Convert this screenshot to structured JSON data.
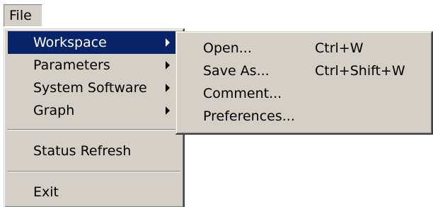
{
  "menubar": {
    "file_label": "File"
  },
  "file_menu": {
    "items": [
      {
        "label": "Workspace"
      },
      {
        "label": "Parameters"
      },
      {
        "label": "System Software"
      },
      {
        "label": "Graph"
      },
      {
        "label": "Status Refresh"
      },
      {
        "label": "Exit"
      }
    ],
    "submenu_arrow_icon": "chevron-right-icon"
  },
  "workspace_submenu": {
    "items": [
      {
        "label": "Open...",
        "shortcut": "Ctrl+W"
      },
      {
        "label": "Save As...",
        "shortcut": "Ctrl+Shift+W"
      },
      {
        "label": "Comment...",
        "shortcut": ""
      },
      {
        "label": "Preferences...",
        "shortcut": ""
      }
    ]
  },
  "colors": {
    "menu_face": "#d4d0c8",
    "highlight": "#0a246a",
    "highlight_text": "#ffffff"
  }
}
